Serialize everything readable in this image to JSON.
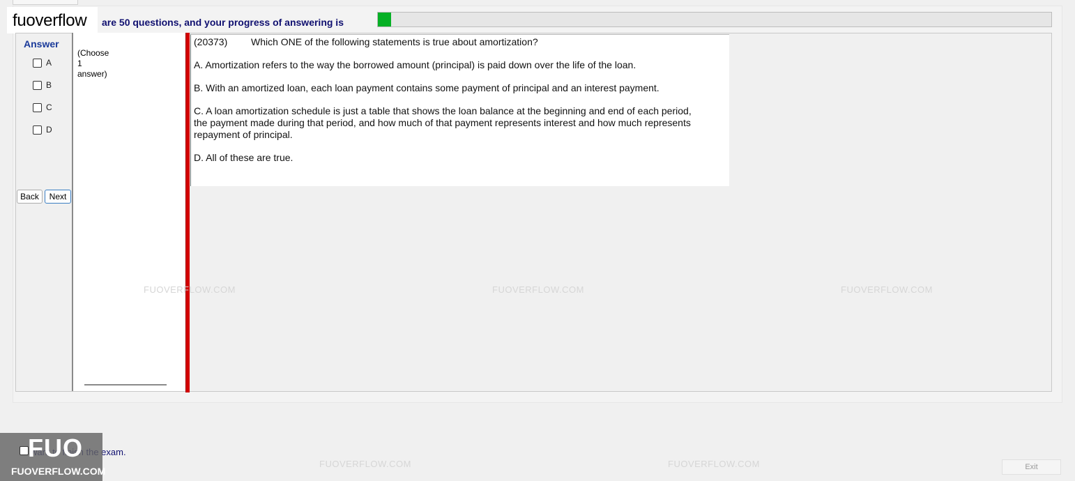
{
  "brand": {
    "name": "fuoverflow"
  },
  "progress": {
    "label": "are 50 questions, and your progress of answering is",
    "value_fraction": 0.02,
    "color": "#06b025"
  },
  "answer_panel": {
    "title": "Answer",
    "options": [
      "A",
      "B",
      "C",
      "D"
    ],
    "back_label": "Back",
    "next_label": "Next"
  },
  "instructions": {
    "choose_line1": "(Choose",
    "choose_line2": "1",
    "choose_line3": "answer)"
  },
  "question": {
    "id": "(20373)",
    "text": "Which ONE of the following statements is true about amortization?",
    "options": [
      "A.  Amortization refers to the way the borrowed amount (principal) is paid down over the life of the loan.",
      "B.  With an amortized loan, each loan payment contains some payment of principal and an interest payment.",
      "C.  A loan amortization schedule is just a table that shows the loan balance at the beginning and end of each period, the payment made during that period, and how much of that payment represents interest and how much represents repayment of principal.",
      "D.  All of these are true."
    ]
  },
  "footer": {
    "finish_label": "want to finish the exam.",
    "exit_label": "Exit"
  },
  "watermark": {
    "big": "FUO",
    "small": "FUOVERFLOW.COM",
    "faint": "FUOVERFLOW.COM"
  }
}
